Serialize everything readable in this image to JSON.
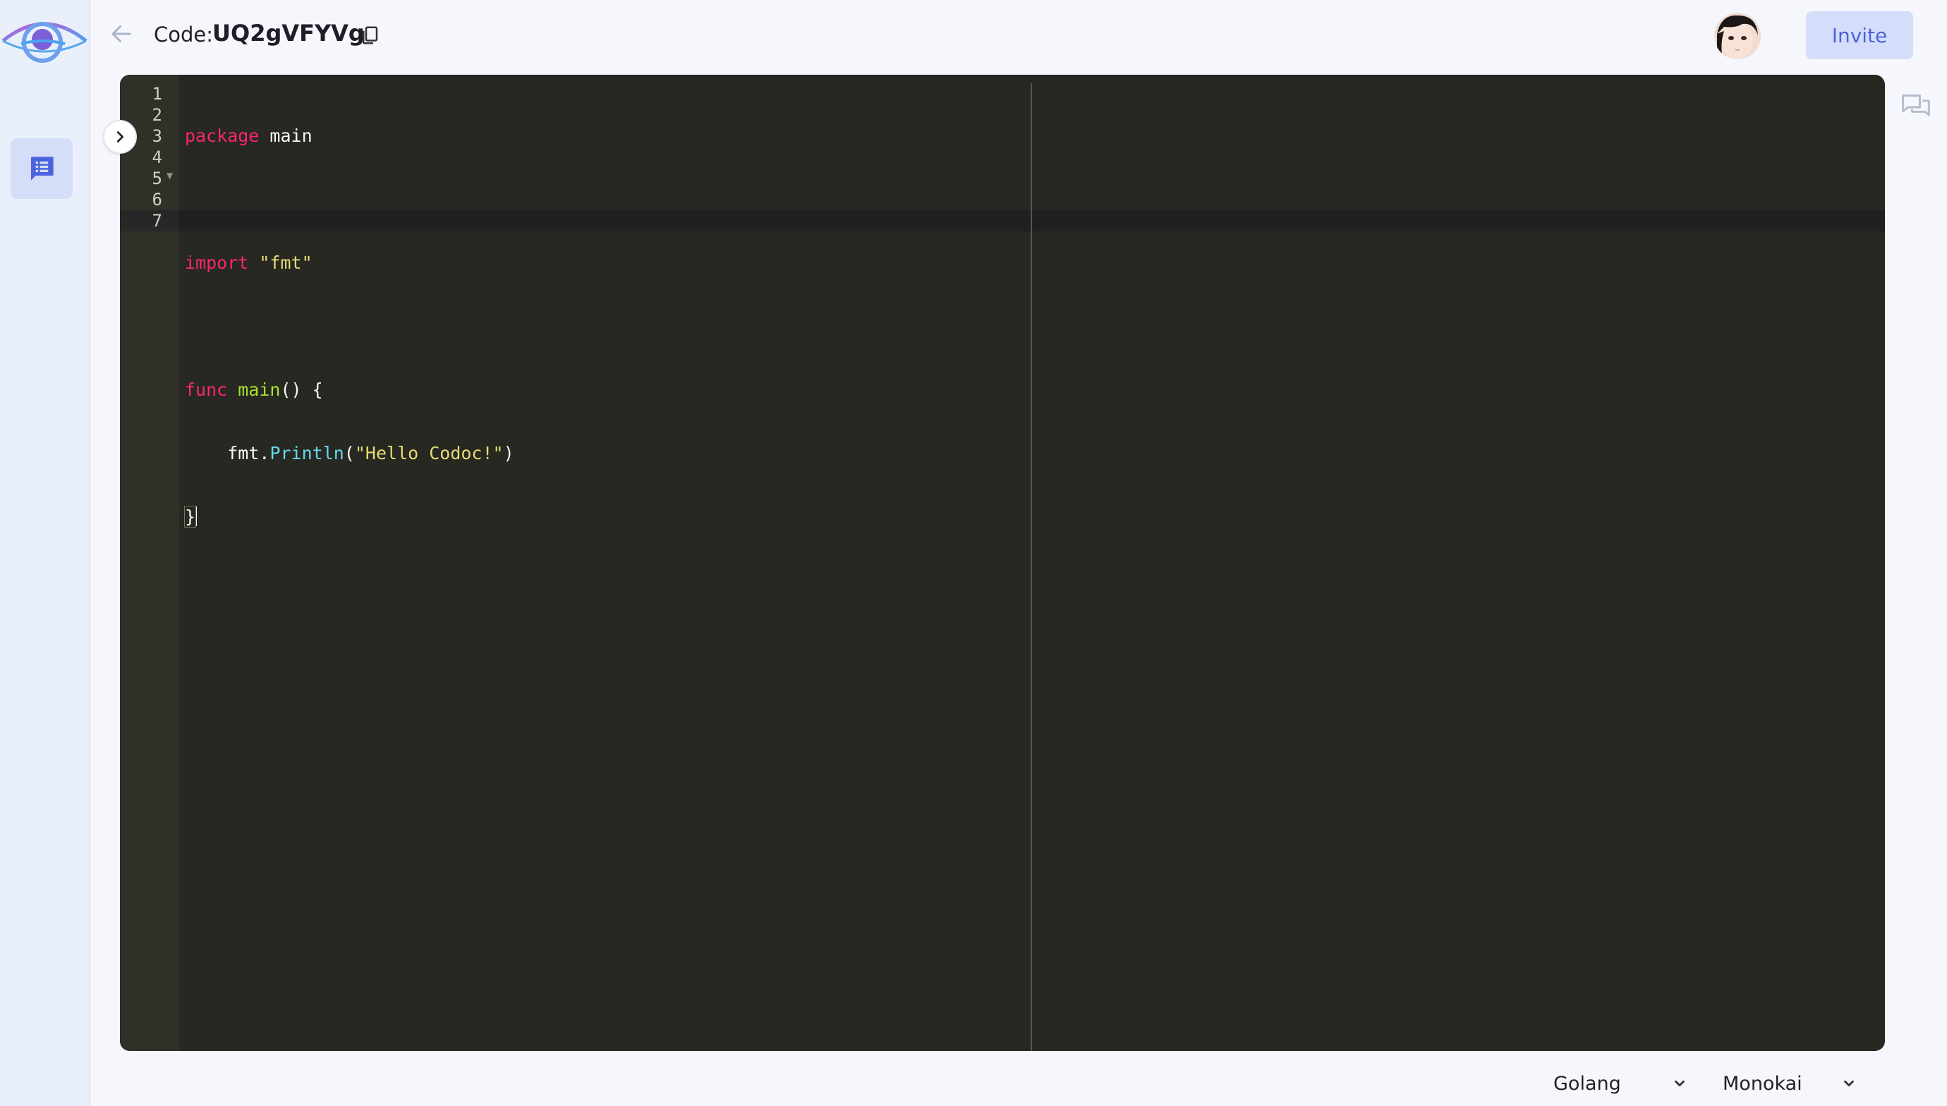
{
  "header": {
    "code_label": "Code:",
    "code_value": "UQ2gVFYVg",
    "invite_label": "Invite"
  },
  "editor": {
    "line_numbers": [
      "1",
      "2",
      "3",
      "4",
      "5",
      "6",
      "7"
    ],
    "lines": {
      "l1": {
        "kw": "package",
        "rest": " main"
      },
      "l3": {
        "kw": "import",
        "str": "\"fmt\""
      },
      "l5": {
        "kw": "func",
        "fn": "main",
        "rest": "() {"
      },
      "l6": {
        "indent": "    ",
        "obj": "fmt.",
        "method": "Println",
        "open": "(",
        "str": "\"Hello Codoc!\"",
        "close": ")"
      },
      "l7": {
        "text": "}"
      }
    }
  },
  "footer": {
    "language": "Golang",
    "theme": "Monokai"
  },
  "colors": {
    "accent": "#4f62d8",
    "editor_bg": "#272822",
    "keyword": "#f92672",
    "string": "#e6db74",
    "function": "#a6e22e",
    "support": "#66d9ef"
  },
  "icons": {
    "logo": "eye-logo-icon",
    "sidebar": "list-chat-icon",
    "back": "arrow-left-icon",
    "copy": "copy-icon",
    "chat": "chat-bubbles-icon",
    "toggle": "chevron-right-icon",
    "select": "chevron-down-icon"
  }
}
